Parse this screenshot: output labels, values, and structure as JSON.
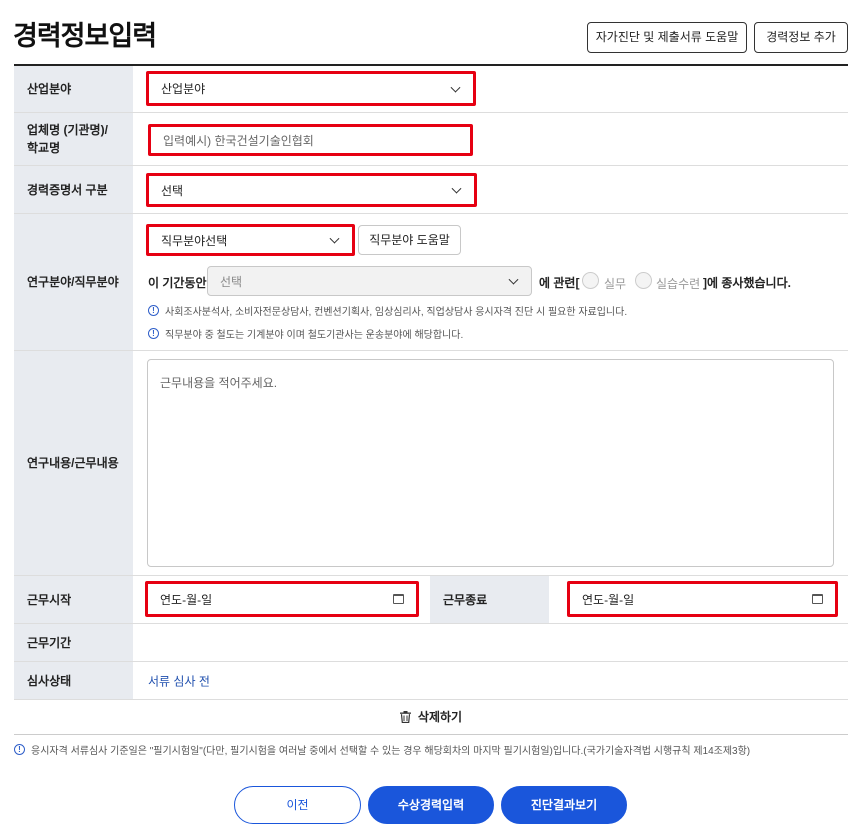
{
  "page": {
    "title": "경력정보입력",
    "guide_button": "자가진단 및 제출서류 도움말",
    "add_button": "경력정보 추가"
  },
  "rows": {
    "industry": {
      "label": "산업분야",
      "value": "산업분야"
    },
    "company": {
      "label_line1": "업체명 (기관명)/",
      "label_line2": "학교명",
      "placeholder": "입력예시) 한국건설기술인협회"
    },
    "cert_type": {
      "label": "경력증명서 구분",
      "value": "선택"
    },
    "field": {
      "label": "연구분야/직무분야",
      "select_value": "직무분야선택",
      "help_button": "직무분야 도움말",
      "period_prefix": "이 기간동안",
      "period_select": "선택",
      "related_text": "에 관련[",
      "radio_practice": "실무",
      "radio_training": "실습수련",
      "engaged_text": "]에 종사했습니다.",
      "note1": "사회조사분석사, 소비자전문상담사, 컨벤션기획사, 임상심리사, 직업상담사 응시자격 진단 시 필요한 자료입니다.",
      "note2": "직무분야 중 철도는 기계분야 이며 철도기관사는 운송분야에 해당합니다."
    },
    "content": {
      "label": "연구내용/근무내용",
      "placeholder": "근무내용을 적어주세요."
    },
    "dates": {
      "start_label": "근무시작",
      "start_value": "연도-월-일",
      "end_label": "근무종료",
      "end_value": "연도-월-일"
    },
    "period": {
      "label": "근무기간",
      "value": ""
    },
    "status": {
      "label": "심사상태",
      "value": "서류 심사 전"
    }
  },
  "delete_label": "삭제하기",
  "bottom_note": "응시자격 서류심사 기준일은 \"필기시험일\"(다만, 필기시험을 여러날 중에서 선택할 수 있는 경우 해당회차의 마지막 필기시험일)입니다.(국가기술자격법 시행규칙 제14조제3항)",
  "buttons": {
    "prev": "이전",
    "award": "수상경력입력",
    "result": "진단결과보기"
  },
  "colors": {
    "accent": "#1a56db",
    "highlight": "#e60012",
    "label_bg": "#e8ebf0"
  }
}
